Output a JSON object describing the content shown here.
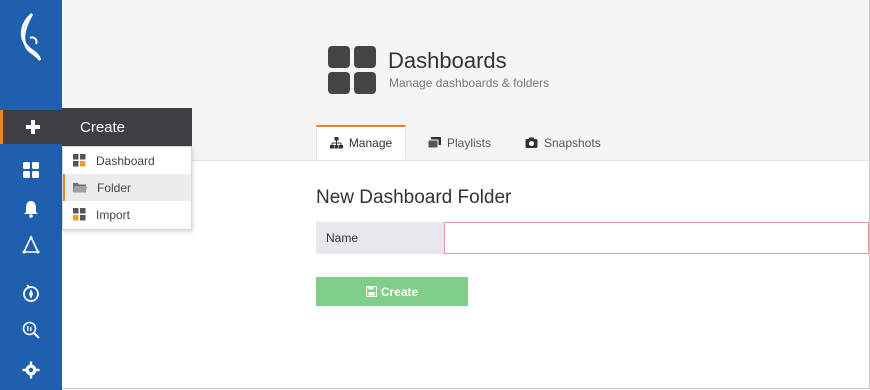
{
  "header": {
    "title": "Dashboards",
    "subtitle": "Manage dashboards & folders"
  },
  "tabs": [
    {
      "label": "Manage",
      "icon": "sitemap-icon",
      "active": true
    },
    {
      "label": "Playlists",
      "icon": "playlist-icon",
      "active": false
    },
    {
      "label": "Snapshots",
      "icon": "camera-icon",
      "active": false
    }
  ],
  "sidebar": {
    "items": [
      "logo",
      "plus-icon",
      "dashboards-icon",
      "bell-icon",
      "explore-icon",
      "compass-icon",
      "search-data-icon",
      "gear-icon"
    ]
  },
  "create_menu": {
    "title": "Create",
    "items": [
      {
        "label": "Dashboard",
        "icon": "dashboard-icon"
      },
      {
        "label": "Folder",
        "icon": "folder-icon"
      },
      {
        "label": "Import",
        "icon": "import-icon"
      }
    ]
  },
  "form": {
    "title": "New Dashboard Folder",
    "name_label": "Name",
    "name_value": "",
    "create_label": "Create"
  },
  "colors": {
    "sidebar": "#1f5fae",
    "accent": "#e8832a",
    "button": "#7fcf8a",
    "menu_dark": "#3d3f44"
  }
}
